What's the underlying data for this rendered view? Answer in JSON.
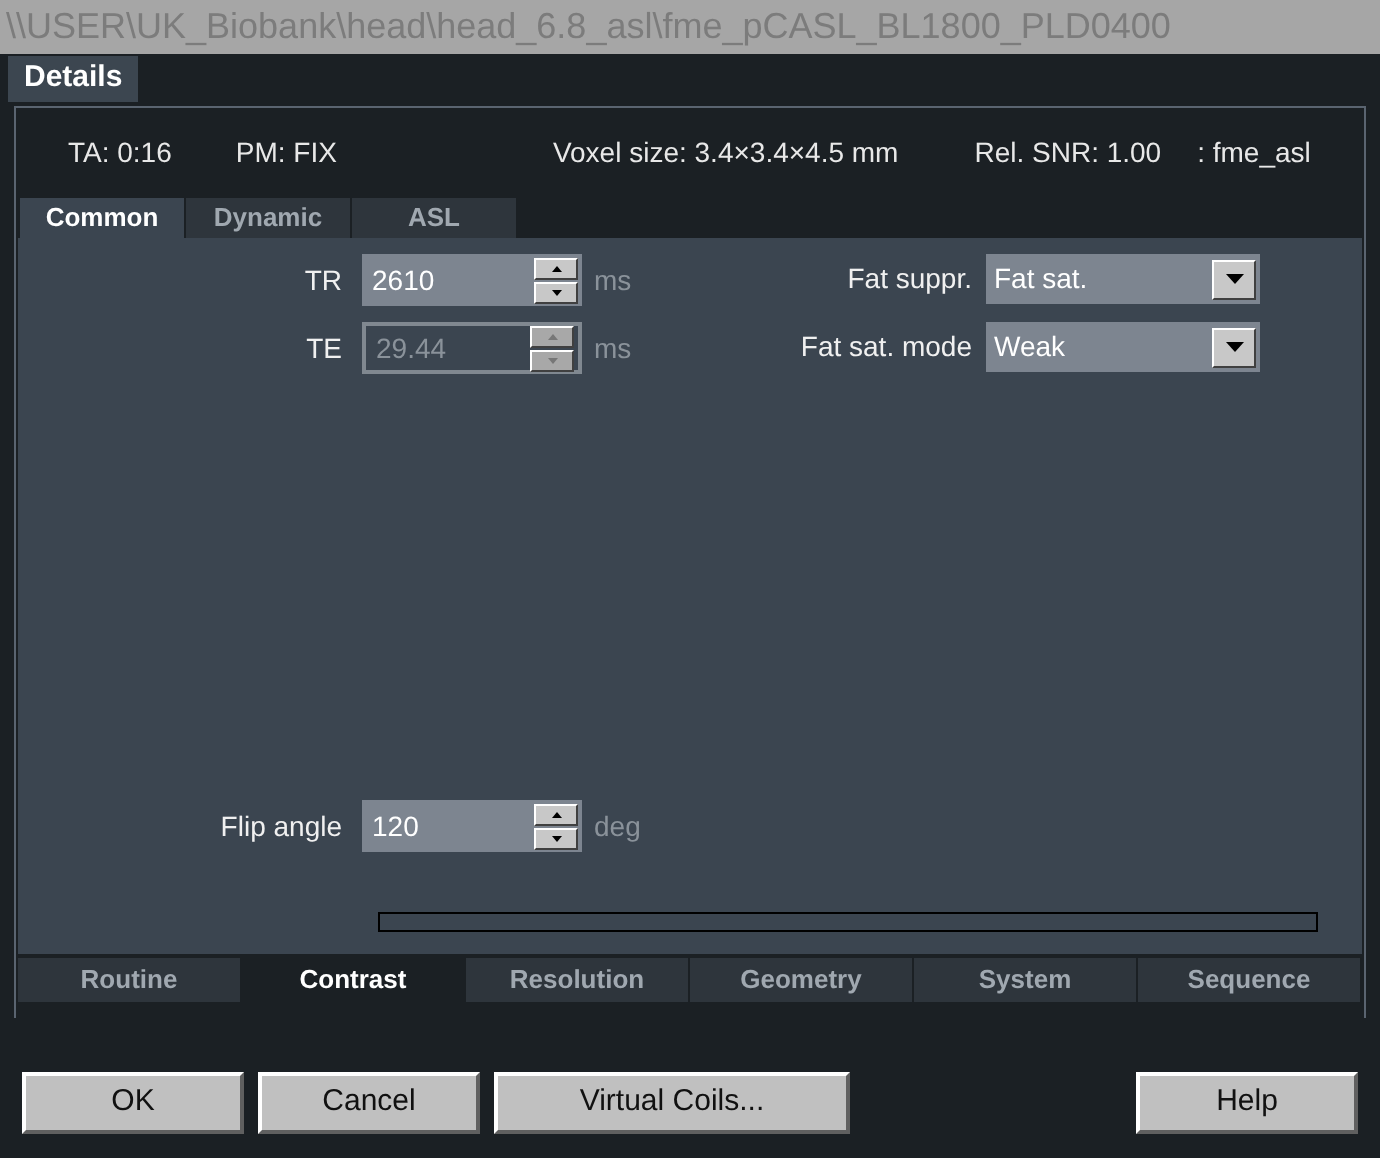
{
  "window": {
    "title": "\\\\USER\\UK_Biobank\\head\\head_6.8_asl\\fme_pCASL_BL1800_PLD0400"
  },
  "top_tabs": [
    {
      "label": "Details",
      "selected": true
    }
  ],
  "info": [
    "TA: 0:16",
    "PM: FIX",
    "Voxel size: 3.4×3.4×4.5 mm",
    "Rel. SNR: 1.00",
    ": fme_asl"
  ],
  "sub_tabs": [
    {
      "label": "Common",
      "selected": true
    },
    {
      "label": "Dynamic",
      "selected": false
    },
    {
      "label": "ASL",
      "selected": false
    }
  ],
  "left_fields": [
    {
      "label": "TR",
      "value": "2610",
      "unit": "ms",
      "disabled": false
    },
    {
      "label": "TE",
      "value": "29.44",
      "unit": "ms",
      "disabled": true
    }
  ],
  "right_fields": [
    {
      "label": "Fat suppr.",
      "value": "Fat sat."
    },
    {
      "label": "Fat sat. mode",
      "value": "Weak"
    }
  ],
  "bottom_field": {
    "label": "Flip angle",
    "value": "120",
    "unit": "deg",
    "disabled": false
  },
  "progress": {
    "level": 0
  },
  "bottom_tabs": [
    {
      "label": "Routine",
      "selected": false
    },
    {
      "label": "Contrast",
      "selected": true
    },
    {
      "label": "Resolution",
      "selected": false
    },
    {
      "label": "Geometry",
      "selected": false
    },
    {
      "label": "System",
      "selected": false
    },
    {
      "label": "Sequence",
      "selected": false
    }
  ],
  "buttons": [
    "OK",
    "Cancel",
    "Virtual Coils..."
  ],
  "help_button": "Help"
}
